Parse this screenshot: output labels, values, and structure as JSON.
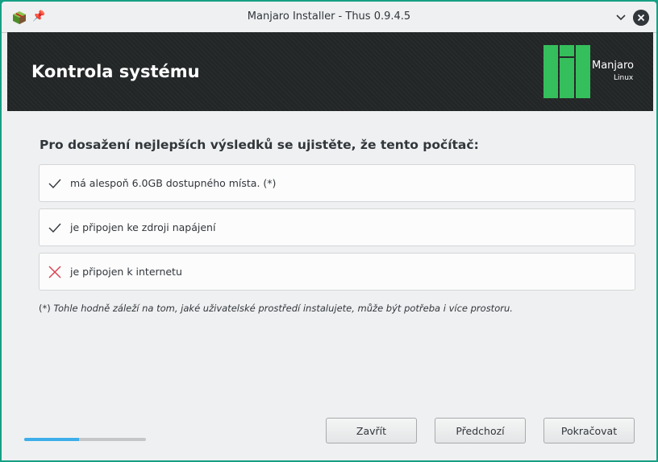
{
  "window": {
    "title": "Manjaro Installer - Thus 0.9.4.5"
  },
  "header": {
    "title": "Kontrola systému",
    "logo_name": "Manjaro",
    "logo_sub": "Linux"
  },
  "content": {
    "heading": "Pro dosažení nejlepších výsledků se ujistěte, že tento počítač:",
    "requirements": [
      {
        "label": "má alespoň 6.0GB dostupného místa. (*)",
        "status": "ok",
        "icon": "check-icon"
      },
      {
        "label": "je připojen ke zdroji napájení",
        "status": "ok",
        "icon": "check-icon"
      },
      {
        "label": "je připojen k internetu",
        "status": "fail",
        "icon": "cross-icon"
      }
    ],
    "note_marker": "(*)",
    "note_text": "Tohle hodně záleží na tom, jaké uživatelské prostředí instalujete, může být potřeba i více prostoru."
  },
  "footer": {
    "progress_fraction": 0.45,
    "buttons": {
      "close": "Zavřít",
      "previous": "Předchozí",
      "next": "Pokračovat"
    }
  },
  "colors": {
    "desktop": "#16a085",
    "manjaro_green": "#35bf5c",
    "fail_red": "#da4453",
    "progress": "#3daee9"
  }
}
